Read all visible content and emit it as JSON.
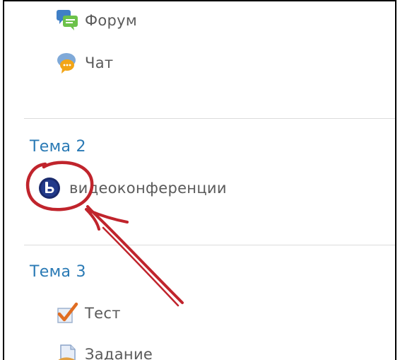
{
  "topic1": {
    "activities": [
      {
        "label": "Форум",
        "icon": "forum-icon"
      },
      {
        "label": "Чат",
        "icon": "chat-icon"
      }
    ]
  },
  "topic2": {
    "title": "Тема 2",
    "activities": [
      {
        "label": "видеоконференции",
        "icon": "bigbluebutton-icon"
      }
    ]
  },
  "topic3": {
    "title": "Тема 3",
    "activities": [
      {
        "label": "Тест",
        "icon": "quiz-icon"
      },
      {
        "label": "Задание",
        "icon": "assignment-icon"
      }
    ]
  },
  "annotation": {
    "color": "#c0242c",
    "shapes": [
      "circle-highlight",
      "arrow"
    ]
  },
  "colors": {
    "section_title": "#2a7ab5",
    "activity_text": "#5a5a5a",
    "divider": "#dcdcdc"
  }
}
